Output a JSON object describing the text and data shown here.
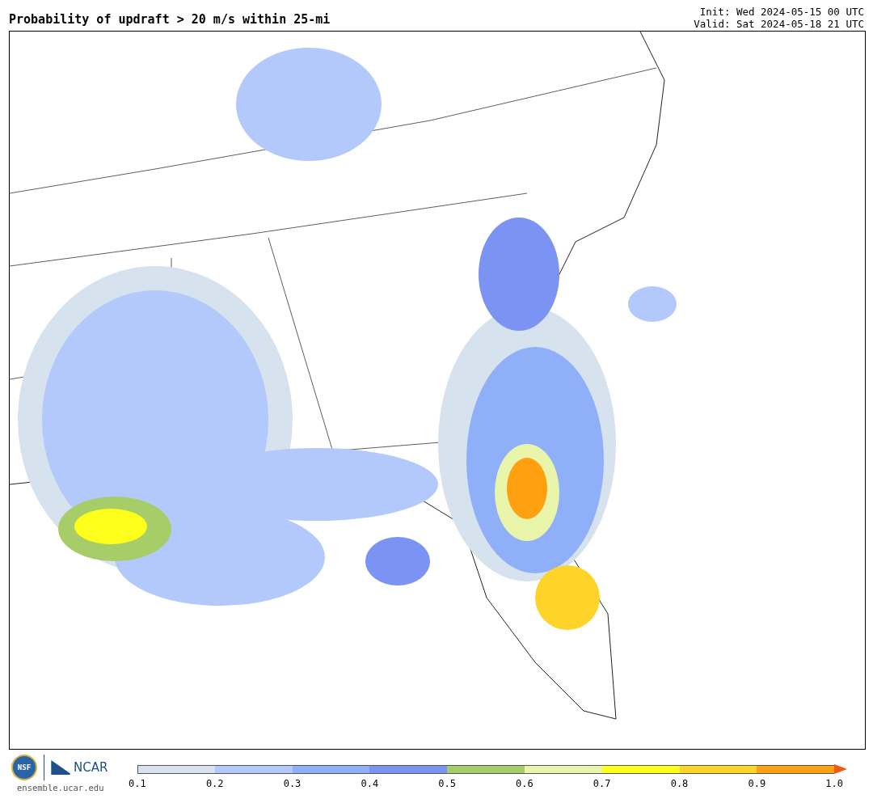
{
  "title": "Probability of updraft > 20 m/s within 25-mi",
  "init": "Init: Wed 2024-05-15 00 UTC",
  "valid": "Valid: Sat 2024-05-18 21 UTC",
  "logos": {
    "left": "NSF",
    "right": "NCAR"
  },
  "website": "ensemble.ucar.edu",
  "colorbar": {
    "bins": [
      {
        "kind": "box",
        "color": "#d6e2ee"
      },
      {
        "kind": "box",
        "color": "#b4c9fb"
      },
      {
        "kind": "box",
        "color": "#8fb0f8"
      },
      {
        "kind": "box",
        "color": "#7b93f2"
      },
      {
        "kind": "box",
        "color": "#a7cd68"
      },
      {
        "kind": "box",
        "color": "#e8f5ab"
      },
      {
        "kind": "box",
        "color": "#ffff1c"
      },
      {
        "kind": "box",
        "color": "#ffd42a"
      },
      {
        "kind": "box",
        "color": "#ffa010"
      },
      {
        "kind": "arrow",
        "color": "#ea5a12"
      }
    ],
    "ticks": [
      "0.1",
      "0.2",
      "0.3",
      "0.4",
      "0.5",
      "0.6",
      "0.7",
      "0.8",
      "0.9",
      "1.0"
    ]
  }
}
